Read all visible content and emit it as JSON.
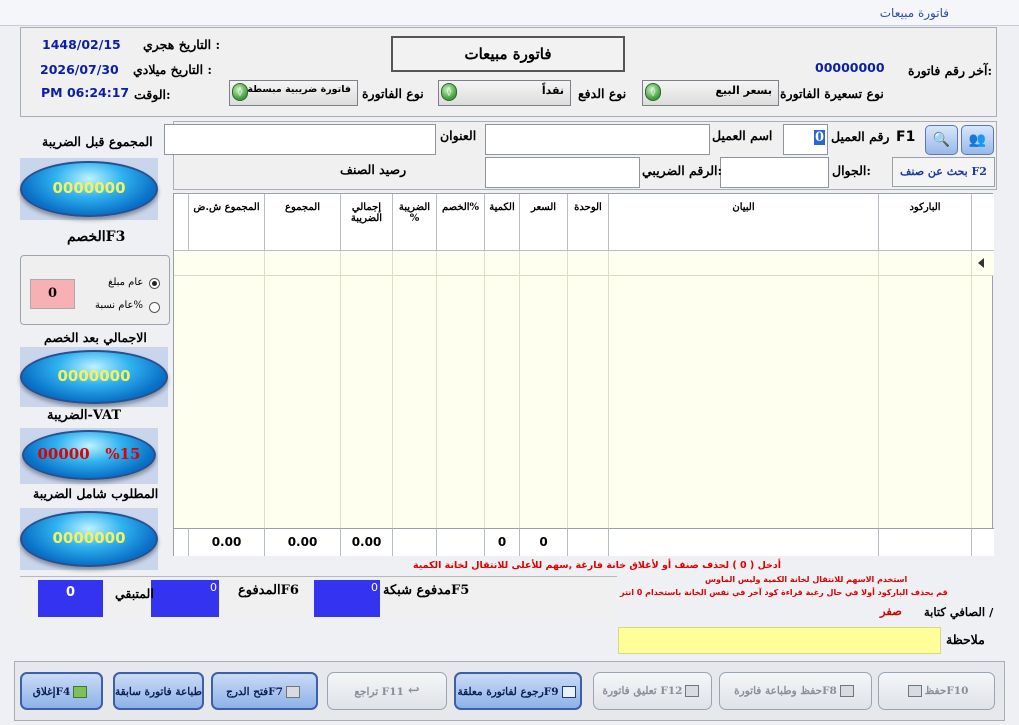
{
  "window": {
    "title": "فاتورة مبيعات"
  },
  "header": {
    "hijri_label": "التاريخ هجري :",
    "hijri_value": "1448/02/15",
    "gregorian_label": "التاريخ ميلادي :",
    "gregorian_value": "2026/07/30",
    "time_label": "الوقت:",
    "time_value": "PM 06:24:17",
    "title_box": "فاتورة مبيعات",
    "last_invoice_label": "آخر رقم فاتورة:",
    "last_invoice_value": "00000000",
    "pricing_label": "نوع تسعيرة الفاتورة",
    "pricing_value": "بسعر البيع",
    "payment_label": "نوع الدفع",
    "payment_value": "نقداً",
    "invoice_type_label": "نوع الفاتورة",
    "invoice_type_value": "فاتورة ضريبية مبسطة"
  },
  "customer": {
    "f1": "F1",
    "customer_no_label": "رقم العميل",
    "customer_no_value": "0",
    "customer_name_label": "اسم العميل",
    "address_label": "العنوان",
    "search_item": "بحث عن صنف F2",
    "mobile_label": "الجوال:",
    "tax_no_label": "الرقم الضريبي:",
    "item_balance_label": "رصيد الصنف"
  },
  "grid": {
    "columns": [
      "الباركود",
      "البيان",
      "الوحدة",
      "السعر",
      "الكمية",
      "الخصم%",
      "الضريبة %",
      "إجمالي الضريبة",
      "المجموع",
      "المجموع ش.ض"
    ],
    "totals": {
      "qty": "0",
      "price": "0",
      "tax_total": "0.00",
      "sum": "0.00",
      "sum_with_tax": "0.00"
    }
  },
  "left_panel": {
    "before_tax_label": "المجموع قبل الضريبة",
    "before_tax_value": "0000000",
    "discount_label": "الخصمF3",
    "discount_value": "0",
    "radio_amount": "عام مبلغ",
    "radio_percent": "عام نسبة%",
    "after_discount_label": "الاجمالي بعد الخصم",
    "after_discount_value": "0000000",
    "vat_label": "الضريبة-VAT",
    "vat_amount": "00000",
    "vat_percent": "%15",
    "due_label": "المطلوب شامل الضريبة",
    "due_value": "0000000"
  },
  "messages": {
    "line1": "أدخل ( 0 ) لحذف صنف أو لأغلاق خانة فارغة ,سهم للأعلى للانتقال لخانة الكمية",
    "line2": "استخدم الاسهم للانتقال لخانة الكمية وليس الماوس",
    "line3": "قم بحذف الباركود أولا في حال رغبة قراءة كود آخر في نفس الخانة باستخدام 0 انتر"
  },
  "payment": {
    "network_label": "مدفوع شبكةF5",
    "network_value": "0",
    "paid_label": "المدفوعF6",
    "paid_value": "0",
    "remaining_label": "المتبقي",
    "remaining_value": "0",
    "net_words_label": "الصافي كتابة /",
    "net_words_value": "صفر",
    "note_label": "ملاحظة"
  },
  "toolbar": {
    "save": "حفظF10",
    "save_print": "حفظ وطباعة فاتورةF8",
    "hold": "تعليق فاتورة F12",
    "recall": "رجوع لفاتورة معلقةF9",
    "return": "تراجع F11",
    "drawer": "فتح الدرجF7",
    "print_prev": "طباعة فاتورة سابقة",
    "close": "إغلاقF4"
  }
}
